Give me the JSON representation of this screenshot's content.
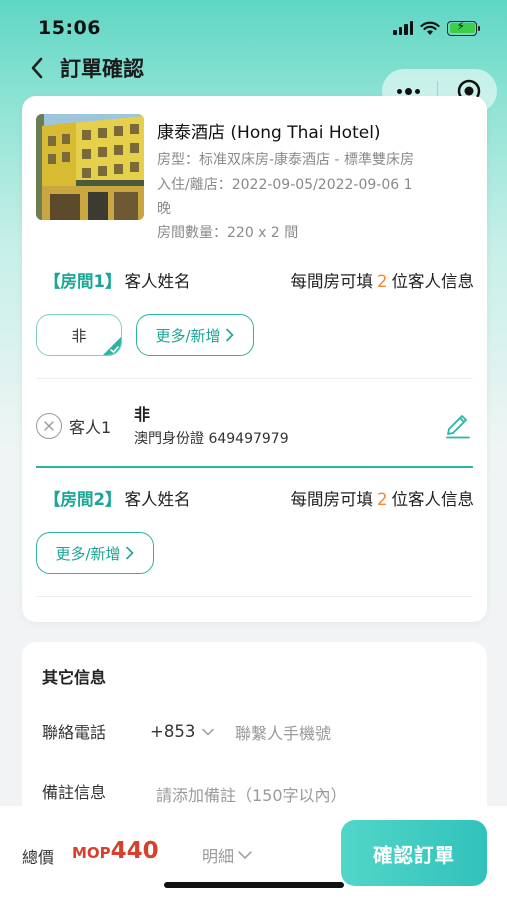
{
  "status_bar": {
    "time": "15:06"
  },
  "nav": {
    "title": "訂單確認"
  },
  "hotel": {
    "name": "康泰酒店 (Hong Thai Hotel)",
    "room_type": "房型：标准双床房-康泰酒店 - 標準雙床房",
    "stay_line1": "入住/離店：2022-09-05/2022-09-06 1",
    "stay_line2": "晚",
    "room_count": "房間數量：220 x 2 間"
  },
  "rooms": [
    {
      "tag": "【房間1】",
      "title": "客人姓名",
      "limit_prefix": "每間房可填",
      "limit_num": "2",
      "limit_suffix": "位客人信息",
      "chip": "非",
      "more_label": "更多/新增",
      "guest": {
        "label": "客人1",
        "name": "非",
        "id": "澳門身份證 649497979"
      }
    },
    {
      "tag": "【房間2】",
      "title": "客人姓名",
      "limit_prefix": "每間房可填",
      "limit_num": "2",
      "limit_suffix": "位客人信息",
      "more_label": "更多/新增"
    }
  ],
  "other": {
    "title": "其它信息",
    "phone_label": "聯絡電話",
    "phone_code": "+853",
    "phone_placeholder": "聯繫人手機號",
    "remark_label": "備註信息",
    "remark_placeholder": "請添加備註（150字以內）"
  },
  "footer": {
    "total_label": "總價",
    "currency": "MOP",
    "amount": "440",
    "detail_label": "明細",
    "confirm_label": "確認訂單"
  },
  "colors": {
    "accent": "#1aa697",
    "price": "#d8402e",
    "highlight_number": "#f08a2c"
  },
  "icons": [
    "back-chevron-icon",
    "more-dots-icon",
    "target-circle-icon",
    "check-corner-icon",
    "chevron-right-icon",
    "remove-circle-icon",
    "pencil-edit-icon",
    "chevron-down-icon"
  ]
}
